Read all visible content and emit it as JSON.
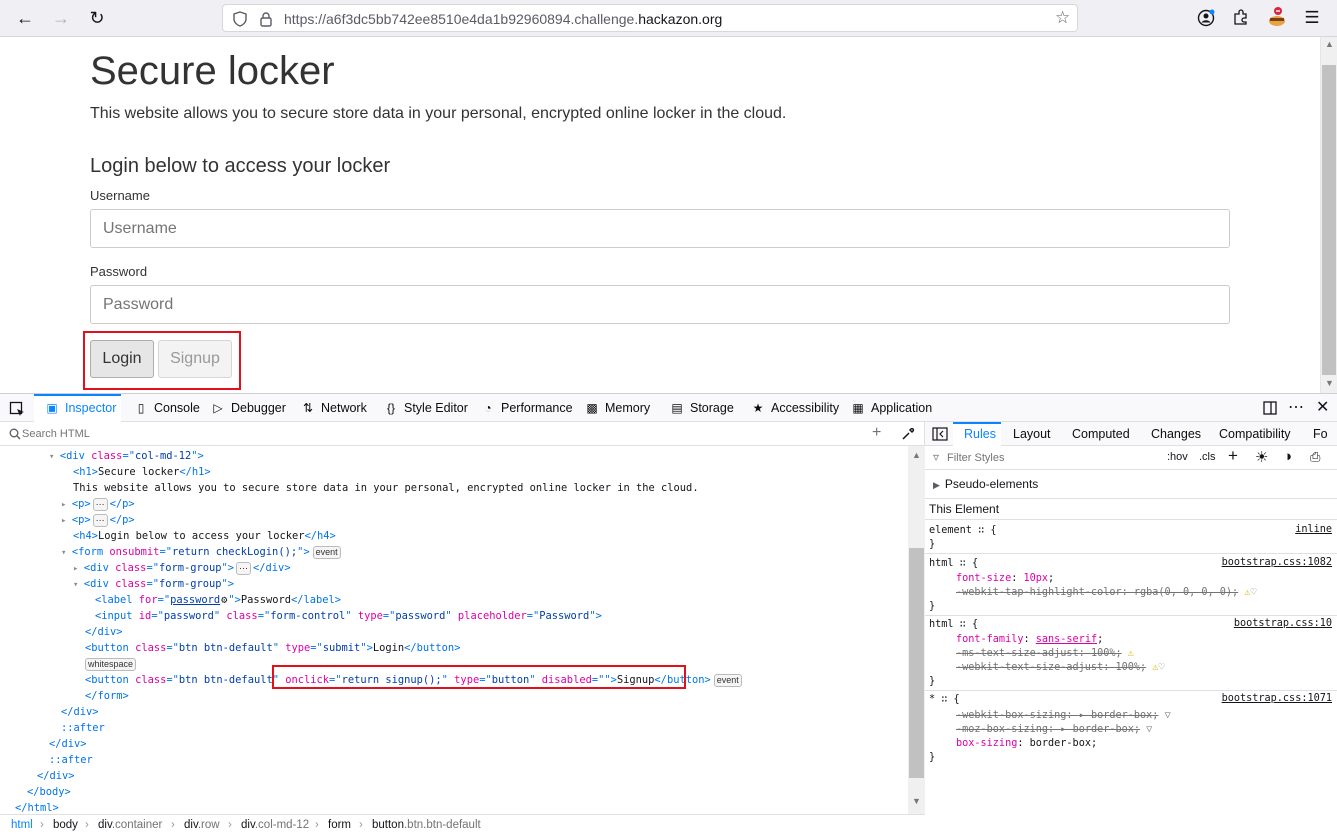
{
  "browser": {
    "url_prefix": "https://a6f3dc5bb742ee8510e4da1b92960894.challenge.",
    "url_domain": "hackazon.org"
  },
  "page": {
    "title": "Secure locker",
    "intro": "This website allows you to secure store data in your personal, encrypted online locker in the cloud.",
    "subtitle": "Login below to access your locker",
    "username_label": "Username",
    "username_placeholder": "Username",
    "password_label": "Password",
    "password_placeholder": "Password",
    "login_label": "Login",
    "signup_label": "Signup"
  },
  "devtools": {
    "tabs": [
      "Inspector",
      "Console",
      "Debugger",
      "Network",
      "Style Editor",
      "Performance",
      "Memory",
      "Storage",
      "Accessibility",
      "Application"
    ],
    "search_placeholder": "Search HTML",
    "tree": [
      {
        "d": "▾",
        "p": [
          "<",
          "div",
          " class",
          "=\"",
          "col-md-12",
          "\">"
        ]
      },
      {
        "t": [
          "<",
          "h1",
          ">",
          "Secure locker",
          "</",
          "h1",
          ">"
        ]
      },
      {
        "text": "This website allows you to secure store data in your personal, encrypted online locker in the cloud."
      },
      {
        "d": "▸",
        "p": [
          "<",
          "p",
          ">"
        ],
        "dots": true,
        "close": [
          "</",
          "p",
          ">"
        ]
      },
      {
        "d": "▸",
        "p": [
          "<",
          "p",
          ">"
        ],
        "dots": true,
        "close": [
          "</",
          "p",
          ">"
        ]
      },
      {
        "t": [
          "<",
          "h4",
          ">",
          "Login below to access your locker",
          "</",
          "h4",
          ">"
        ]
      },
      {
        "form": true
      },
      {
        "d": "▸",
        "p": [
          "<",
          "div",
          " class",
          "=\"",
          "form-group",
          "\">"
        ],
        "dots": true,
        "close": [
          "</",
          "div",
          ">"
        ]
      },
      {
        "d": "▾",
        "p": [
          "<",
          "div",
          " class",
          "=\"",
          "form-group",
          "\">"
        ]
      },
      {
        "label": true
      },
      {
        "input": true
      },
      {
        "close": [
          "</",
          "div",
          ">"
        ]
      },
      {
        "btn1": true
      },
      {
        "ws": "whitespace"
      },
      {
        "btn2": true
      },
      {
        "close": [
          "</",
          "form",
          ">"
        ]
      },
      {
        "close": [
          "</",
          "div",
          ">"
        ]
      },
      {
        "pseudo": "::after"
      },
      {
        "close": [
          "</",
          "div",
          ">"
        ]
      },
      {
        "pseudo": "::after"
      },
      {
        "close": [
          "</",
          "div",
          ">"
        ]
      },
      {
        "close": [
          "</",
          "body",
          ">"
        ]
      },
      {
        "close": [
          "</",
          "html",
          ">"
        ]
      }
    ],
    "tree_strings": {
      "form_onsubmit": "return checkLogin();",
      "label_for": "password",
      "label_text": "Password",
      "input_attrs": {
        "id": "password",
        "class": "form-control",
        "type": "password",
        "placeholder": "Password"
      },
      "btn1_class": "btn btn-default",
      "btn1_type": "submit",
      "btn1_text": "Login",
      "btn2_class": "btn btn-default",
      "btn2_onclick": "return signup();",
      "btn2_type": "button",
      "btn2_disabled": "",
      "btn2_text": "Signup",
      "event_badge": "event"
    },
    "breadcrumb": [
      {
        "tag": "html",
        "cls": ""
      },
      {
        "tag": "body",
        "cls": ""
      },
      {
        "tag": "div",
        "cls": ".container"
      },
      {
        "tag": "div",
        "cls": ".row"
      },
      {
        "tag": "div",
        "cls": ".col-md-12"
      },
      {
        "tag": "form",
        "cls": ""
      },
      {
        "tag": "button",
        "cls": ".btn.btn-default"
      }
    ],
    "sidebar_tabs": [
      "Rules",
      "Layout",
      "Computed",
      "Changes",
      "Compatibility",
      "Fo"
    ],
    "filter_placeholder": "Filter Styles",
    "hov": ":hov",
    "cls": ".cls",
    "pseudo_elements": "Pseudo-elements",
    "this_element": "This Element",
    "rules": {
      "element_sel": "element",
      "element_src": "inline",
      "r1_sel": "html",
      "r1_src": "bootstrap.css:1082",
      "r1_p1": "font-size",
      "r1_v1": "10px",
      "r1_p2": "-webkit-tap-highlight-color",
      "r1_v2": "rgba(0, 0, 0, 0)",
      "r2_sel": "html",
      "r2_src": "bootstrap.css:10",
      "r2_p1": "font-family",
      "r2_v1": "sans-serif",
      "r2_p2": "-ms-text-size-adjust",
      "r2_v2": "100%",
      "r2_p3": "-webkit-text-size-adjust",
      "r2_v3": "100%",
      "r3_sel": "*",
      "r3_src": "bootstrap.css:1071",
      "r3_p1": "-webkit-box-sizing",
      "r3_v1": "border-box",
      "r3_p2": "-moz-box-sizing",
      "r3_v2": "border-box",
      "r3_p3": "box-sizing",
      "r3_v3": "border-box"
    }
  }
}
